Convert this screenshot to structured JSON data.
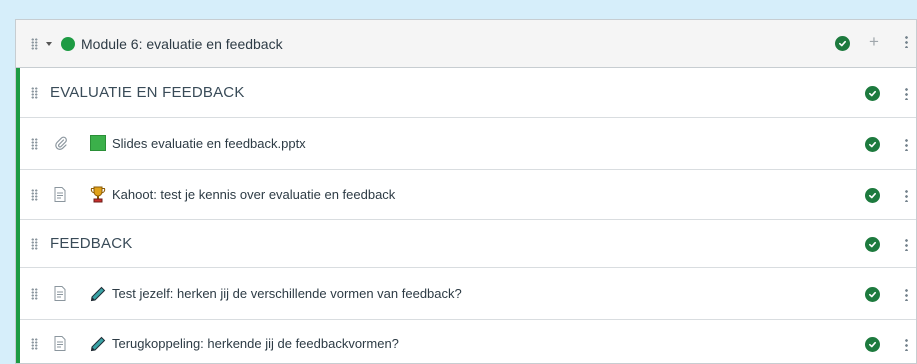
{
  "module": {
    "title": "Module 6: evaluatie en feedback",
    "published": true,
    "status_color": "#1d9b43",
    "icons": [
      "drag-handle-icon",
      "caret-down-icon",
      "published-dot-icon",
      "published-check-icon",
      "plus-icon",
      "kebab-menu-icon"
    ]
  },
  "items": [
    {
      "kind": "header",
      "label": "EVALUATIE EN FEEDBACK",
      "published": true
    },
    {
      "kind": "attachment",
      "type_icon": "paperclip-icon",
      "badge_icon": "green-square-icon",
      "label": "Slides evaluatie en feedback.pptx",
      "published": true
    },
    {
      "kind": "page",
      "type_icon": "document-icon",
      "badge_icon": "trophy-icon",
      "label": "Kahoot: test je kennis over evaluatie en feedback",
      "published": true
    },
    {
      "kind": "header",
      "label": "FEEDBACK",
      "published": true
    },
    {
      "kind": "page",
      "type_icon": "document-icon",
      "badge_icon": "pencil-icon",
      "label": "Test jezelf: herken jij de verschillende vormen van feedback?",
      "published": true
    },
    {
      "kind": "page",
      "type_icon": "document-icon",
      "badge_icon": "pencil-icon",
      "label": "Terugkoppeling: herkende jij de feedbackvormen?",
      "published": true
    }
  ]
}
